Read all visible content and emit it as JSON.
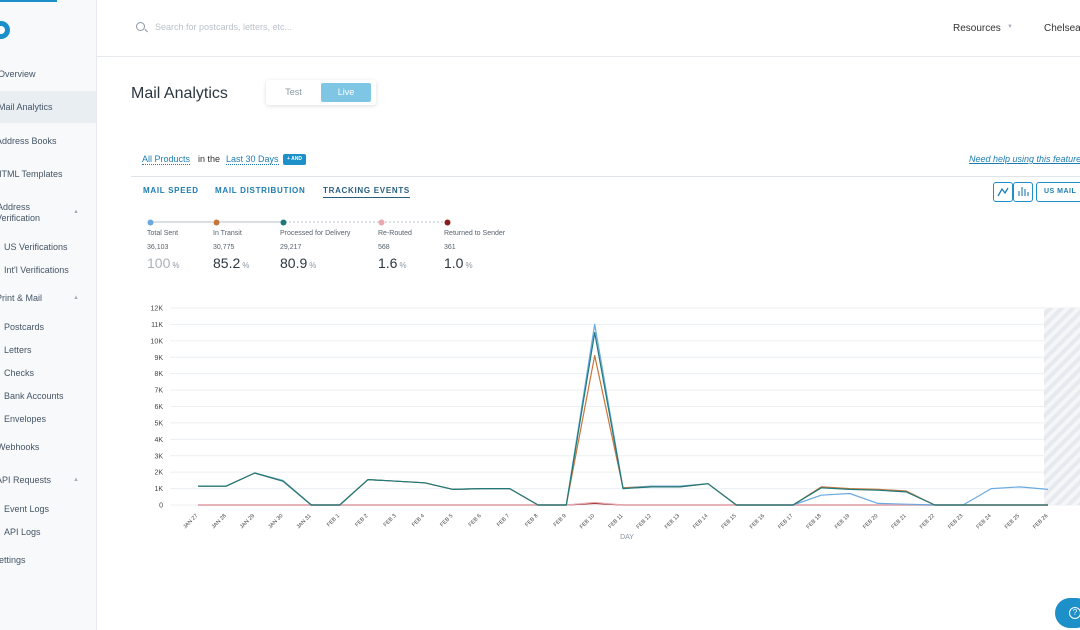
{
  "sidebar": {
    "items": [
      {
        "label": "Overview"
      },
      {
        "label": "Mail Analytics"
      },
      {
        "label": "Address Books"
      },
      {
        "label": "HTML Templates"
      },
      {
        "label": "Address"
      },
      {
        "label": "Verification"
      },
      {
        "label": "US Verifications"
      },
      {
        "label": "Int'l Verifications"
      },
      {
        "label": "Print & Mail"
      },
      {
        "label": "Postcards"
      },
      {
        "label": "Letters"
      },
      {
        "label": "Checks"
      },
      {
        "label": "Bank Accounts"
      },
      {
        "label": "Envelopes"
      },
      {
        "label": "Webhooks"
      },
      {
        "label": "API Requests"
      },
      {
        "label": "Event Logs"
      },
      {
        "label": "API Logs"
      },
      {
        "label": "Settings"
      }
    ]
  },
  "topbar": {
    "search_placeholder": "Search for postcards, letters, etc...",
    "resources_label": "Resources",
    "user_name": "Chelsea"
  },
  "page": {
    "title": "Mail Analytics",
    "mode_test": "Test",
    "mode_live": "Live"
  },
  "filters": {
    "product": "All Products",
    "connector": "in the",
    "range": "Last 30 Days",
    "add_label": "+ AND",
    "help": "Need help using this feature?"
  },
  "tabs": [
    {
      "label": "MAIL SPEED"
    },
    {
      "label": "MAIL DISTRIBUTION"
    },
    {
      "label": "TRACKING EVENTS"
    }
  ],
  "controls": {
    "line_chart_icon": "line-chart-icon",
    "bar_chart_icon": "bar-chart-icon",
    "mail_type": "US MAIL"
  },
  "stats": [
    {
      "label": "Total Sent",
      "count": "36,103",
      "pct": "100",
      "unit": "%",
      "color": "#6aa9e0"
    },
    {
      "label": "In Transit",
      "count": "30,775",
      "pct": "85.2",
      "unit": "%",
      "color": "#c8753a"
    },
    {
      "label": "Processed for Delivery",
      "count": "29,217",
      "pct": "80.9",
      "unit": "%",
      "color": "#1e7a7a"
    },
    {
      "label": "Re-Routed",
      "count": "568",
      "pct": "1.6",
      "unit": "%",
      "color": "#e8a8b0"
    },
    {
      "label": "Returned to Sender",
      "count": "361",
      "pct": "1.0",
      "unit": "%",
      "color": "#8b1c1c"
    }
  ],
  "chart_data": {
    "type": "line",
    "xlabel": "DAY",
    "ylabel": "",
    "ylim": [
      0,
      12000
    ],
    "ytick_labels": [
      "0",
      "1K",
      "2K",
      "3K",
      "4K",
      "5K",
      "6K",
      "7K",
      "8K",
      "9K",
      "10K",
      "11K",
      "12K"
    ],
    "categories": [
      "JAN 27",
      "JAN 28",
      "JAN 29",
      "JAN 30",
      "JAN 31",
      "FEB 1",
      "FEB 2",
      "FEB 3",
      "FEB 4",
      "FEB 5",
      "FEB 6",
      "FEB 7",
      "FEB 8",
      "FEB 9",
      "FEB 10",
      "FEB 11",
      "FEB 12",
      "FEB 13",
      "FEB 14",
      "FEB 15",
      "FEB 16",
      "FEB 17",
      "FEB 18",
      "FEB 19",
      "FEB 20",
      "FEB 21",
      "FEB 22",
      "FEB 23",
      "FEB 24",
      "FEB 25",
      "FEB 26"
    ],
    "grid": true,
    "hatched_last_period": true,
    "series": [
      {
        "name": "Total Sent",
        "color": "#6aa9e0",
        "values": [
          1150,
          1150,
          1950,
          1500,
          0,
          0,
          1550,
          1450,
          1350,
          950,
          1000,
          1000,
          0,
          0,
          11000,
          1050,
          1150,
          1150,
          1300,
          0,
          0,
          0,
          600,
          700,
          100,
          50,
          0,
          0,
          1000,
          1100,
          950
        ]
      },
      {
        "name": "In Transit",
        "color": "#c8753a",
        "values": [
          1150,
          1150,
          1950,
          1450,
          0,
          0,
          1550,
          1450,
          1350,
          950,
          1000,
          1000,
          0,
          0,
          9100,
          1050,
          1100,
          1100,
          1300,
          0,
          0,
          0,
          1100,
          1000,
          950,
          850,
          0,
          0,
          0,
          0,
          0
        ]
      },
      {
        "name": "Processed for Delivery",
        "color": "#1e7a7a",
        "values": [
          1150,
          1150,
          1950,
          1450,
          0,
          0,
          1550,
          1450,
          1350,
          950,
          1000,
          1000,
          0,
          0,
          10500,
          1000,
          1100,
          1100,
          1300,
          0,
          0,
          0,
          1050,
          950,
          900,
          800,
          0,
          0,
          0,
          0,
          0
        ]
      },
      {
        "name": "Re-Routed",
        "color": "#e8a8b0",
        "values": [
          0,
          0,
          0,
          0,
          0,
          0,
          0,
          0,
          0,
          0,
          0,
          0,
          0,
          0,
          150,
          0,
          0,
          0,
          0,
          0,
          0,
          0,
          0,
          0,
          0,
          0,
          0,
          0,
          0,
          0,
          0
        ]
      },
      {
        "name": "Returned to Sender",
        "color": "#8b1c1c",
        "values": [
          0,
          0,
          0,
          0,
          0,
          0,
          0,
          0,
          0,
          0,
          0,
          0,
          0,
          0,
          100,
          0,
          0,
          0,
          0,
          0,
          0,
          0,
          0,
          0,
          0,
          0,
          0,
          0,
          0,
          0,
          0
        ]
      }
    ]
  }
}
